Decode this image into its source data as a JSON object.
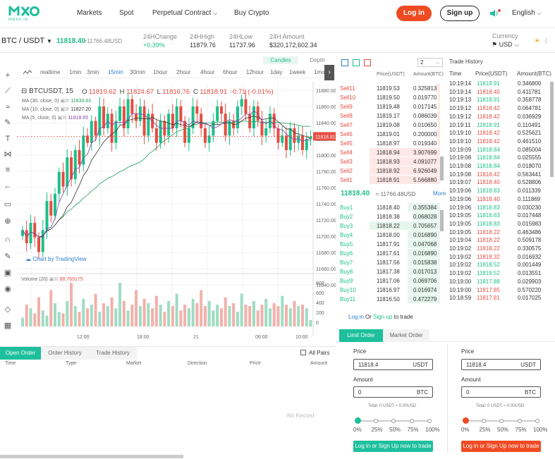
{
  "colors": {
    "green": "#1dbf8a",
    "red": "#e54d42",
    "accent": "#f04a23",
    "teal": "#1dbf9c"
  },
  "header": {
    "logo_main": "mexo",
    "logo_sub": "mexo.io",
    "nav": [
      "Markets",
      "Spot",
      "Perpetual Contract",
      "Buy Crypto"
    ],
    "login": "Log in",
    "signup": "Sign up",
    "language": "English"
  },
  "ticker": {
    "pair": "BTC / USDT",
    "price": "11818.40",
    "price_usd": "≈11766.48USD",
    "stats": [
      {
        "label": "24HChange",
        "value": "+0.39%"
      },
      {
        "label": "24HHigh",
        "value": "11879.76"
      },
      {
        "label": "24HLow",
        "value": "11737.96"
      },
      {
        "label": "24H Amount",
        "value": "$320,172,602.34"
      }
    ],
    "currency_label": "Currency",
    "currency": "USD"
  },
  "chart": {
    "tabs": [
      "Candles",
      "Depth"
    ],
    "intervals": [
      "realtime",
      "1min",
      "3min",
      "15min",
      "30min",
      "1hour",
      "2hour",
      "4hour",
      "6hour",
      "12hour",
      "1day",
      "1week",
      "1mon"
    ],
    "active_interval": "15min",
    "symbol": "BTCUSDT, 15",
    "ohlc": {
      "o_label": "O",
      "o": "11819.62",
      "h_label": "H",
      "h": "11824.67",
      "l_label": "L",
      "l": "11816.76",
      "c_label": "C",
      "c": "11818.91",
      "chg": "-0.71 (-0.01%)"
    },
    "ma": [
      {
        "label": "MA (30, close, 0)",
        "value": "11833.63",
        "color": "#1d9a5a"
      },
      {
        "label": "MA (10, close, 0)",
        "value": "11827.20",
        "color": "#333"
      },
      {
        "label": "MA (5, close, 0)",
        "value": "11818.65",
        "color": "#8a3fa8"
      }
    ],
    "price_ticks": [
      "11880.00",
      "11860.00",
      "11840.00",
      "11820.00",
      "11800.00",
      "11780.00",
      "11760.00",
      "11740.00",
      "11720.00",
      "11700.00",
      "11680.00",
      "11660.00",
      "11640.00"
    ],
    "current_price": "11818.91",
    "volume_label": "Volume (20)",
    "volume_value": "88.769175",
    "volume_ticks": [
      "800",
      "600",
      "400",
      "200",
      "0"
    ],
    "time_ticks": [
      "12:00",
      "18:00",
      "21",
      "06:00",
      "10:00"
    ],
    "watermark": "Chart by TradingView"
  },
  "chart_data": {
    "type": "candlestick",
    "title": "BTCUSDT, 15",
    "ylim": [
      11640,
      11890
    ],
    "closes": [
      11690,
      11672,
      11700,
      11680,
      11660,
      11690,
      11730,
      11710,
      11740,
      11770,
      11750,
      11790,
      11760,
      11800,
      11780,
      11820,
      11810,
      11840,
      11820,
      11860,
      11830,
      11850,
      11810,
      11840,
      11860,
      11830,
      11870,
      11850,
      11840,
      11860,
      11820,
      11850,
      11830,
      11810,
      11840,
      11820,
      11850,
      11830,
      11860,
      11840,
      11810,
      11830,
      11860,
      11850,
      11830,
      11810,
      11820,
      11840,
      11860,
      11850,
      11820,
      11840,
      11830,
      11860,
      11870,
      11850,
      11830,
      11860,
      11840,
      11820,
      11830,
      11850,
      11830,
      11810,
      11820,
      11800,
      11830,
      11810,
      11820,
      11800,
      11815,
      11819
    ],
    "volumes": [
      120,
      300,
      250,
      180,
      400,
      220,
      150,
      500,
      320,
      200,
      180,
      350,
      600,
      280,
      200,
      380,
      250,
      300,
      450,
      200,
      320,
      280,
      400,
      250,
      600,
      350,
      220,
      300,
      500,
      280,
      380,
      320,
      250,
      420,
      300,
      200,
      350,
      280,
      450,
      220,
      300,
      250,
      380,
      320,
      500,
      280,
      350,
      220,
      300,
      250,
      400,
      280,
      320,
      200,
      450,
      300,
      280,
      350,
      220,
      300,
      380,
      250,
      320,
      280,
      420,
      300,
      250,
      350,
      280,
      300,
      250,
      89
    ]
  },
  "orderbook": {
    "precision": "2",
    "col_price": "Price(USDT)",
    "col_amount": "Amount(BTC)",
    "sells": [
      {
        "label": "Sell11",
        "price": "11819.53",
        "amount": "0.325813",
        "depth": 0.04
      },
      {
        "label": "Sell10",
        "price": "11819.50",
        "amount": "0.019770",
        "depth": 0.02
      },
      {
        "label": "Sell9",
        "price": "11819.48",
        "amount": "0.017145",
        "depth": 0.02
      },
      {
        "label": "Sell8",
        "price": "11819.17",
        "amount": "0.086039",
        "depth": 0.03
      },
      {
        "label": "Sell7",
        "price": "11819.08",
        "amount": "0.010650",
        "depth": 0.02
      },
      {
        "label": "Sell6",
        "price": "11819.01",
        "amount": "0.200000",
        "depth": 0.04
      },
      {
        "label": "Sell5",
        "price": "11818.97",
        "amount": "0.019340",
        "depth": 0.02
      },
      {
        "label": "Sell4",
        "price": "11818.94",
        "amount": "3.907699",
        "depth": 0.65
      },
      {
        "label": "Sell3",
        "price": "11818.93",
        "amount": "4.091077",
        "depth": 0.65
      },
      {
        "label": "Sell2",
        "price": "11818.92",
        "amount": "6.926049",
        "depth": 0.65
      },
      {
        "label": "Sell1",
        "price": "11818.91",
        "amount": "5.566880",
        "depth": 0.65
      }
    ],
    "mid_price": "11818.40",
    "mid_usd": "≈ 11766.48USD",
    "more": "More",
    "buys": [
      {
        "label": "Buy1",
        "price": "11818.40",
        "amount": "0.355384",
        "depth": 0.3
      },
      {
        "label": "Buy2",
        "price": "11818.38",
        "amount": "0.068028",
        "depth": 0.25
      },
      {
        "label": "Buy3",
        "price": "11818.22",
        "amount": "0.705657",
        "depth": 0.65
      },
      {
        "label": "Buy4",
        "price": "11818.00",
        "amount": "0.016890",
        "depth": 0.3
      },
      {
        "label": "Buy5",
        "price": "11817.91",
        "amount": "0.047068",
        "depth": 0.3
      },
      {
        "label": "Buy6",
        "price": "11817.61",
        "amount": "0.016890",
        "depth": 0.3
      },
      {
        "label": "Buy7",
        "price": "11817.56",
        "amount": "0.015838",
        "depth": 0.3
      },
      {
        "label": "Buy8",
        "price": "11817.38",
        "amount": "0.017013",
        "depth": 0.3
      },
      {
        "label": "Buy9",
        "price": "11817.06",
        "amount": "0.069706",
        "depth": 0.3
      },
      {
        "label": "Buy10",
        "price": "11816.97",
        "amount": "0.016974",
        "depth": 0.3
      },
      {
        "label": "Buy11",
        "price": "11816.50",
        "amount": "0.472279",
        "depth": 0.3
      }
    ]
  },
  "trade_history": {
    "title": "Trade History",
    "cols": [
      "Time",
      "Price(USDT)",
      "Amount(BTC)"
    ],
    "rows": [
      [
        "10:19:14",
        "11818.91",
        "0.346800",
        "g"
      ],
      [
        "10:19:14",
        "11818.40",
        "0.411781",
        "r"
      ],
      [
        "10:19:13",
        "11818.91",
        "0.358778",
        "g"
      ],
      [
        "10:19:12",
        "11818.42",
        "0.064781",
        "r"
      ],
      [
        "10:19:12",
        "11818.42",
        "0.036929",
        "r"
      ],
      [
        "10:19:11",
        "11818.91",
        "0.110491",
        "g"
      ],
      [
        "10:19:10",
        "11818.42",
        "0.525621",
        "r"
      ],
      [
        "10:19:10",
        "11818.42",
        "0.461510",
        "r"
      ],
      [
        "10:19:09",
        "11818.84",
        "0.085004",
        "g"
      ],
      [
        "10:19:08",
        "11818.84",
        "0.025555",
        "g"
      ],
      [
        "10:19:08",
        "11818.84",
        "0.018070",
        "g"
      ],
      [
        "10:19:08",
        "11818.42",
        "0.563441",
        "r"
      ],
      [
        "10:19:07",
        "11818.40",
        "0.528806",
        "r"
      ],
      [
        "10:19:06",
        "11818.83",
        "0.011339",
        "g"
      ],
      [
        "10:19:06",
        "11818.40",
        "0.111869",
        "r"
      ],
      [
        "10:19:06",
        "11818.83",
        "0.030230",
        "g"
      ],
      [
        "10:19:05",
        "11818.83",
        "0.017448",
        "g"
      ],
      [
        "10:19:05",
        "11818.83",
        "0.015983",
        "g"
      ],
      [
        "10:19:05",
        "11818.22",
        "0.463486",
        "r"
      ],
      [
        "10:19:04",
        "11818.22",
        "0.509178",
        "r"
      ],
      [
        "10:19:02",
        "11818.22",
        "0.330575",
        "r"
      ],
      [
        "10:19:02",
        "11818.32",
        "0.016932",
        "r"
      ],
      [
        "10:19:02",
        "11818.52",
        "0.001449",
        "g"
      ],
      [
        "10:19:02",
        "11818.52",
        "0.013551",
        "g"
      ],
      [
        "10:19:00",
        "11817.88",
        "0.029903",
        "g"
      ],
      [
        "10:19:00",
        "11817.85",
        "0.570220",
        "r"
      ],
      [
        "10:18:59",
        "11817.81",
        "0.017025",
        "r"
      ]
    ]
  },
  "orders": {
    "tabs": [
      "Open Order",
      "Order History",
      "Trade History"
    ],
    "all_pairs": "All Pairs",
    "cols": [
      "Time",
      "Type",
      "Market",
      "Direction",
      "Price",
      "Amount"
    ],
    "empty": "No Record"
  },
  "trade": {
    "login_prompt_login": "Log in",
    "login_prompt_or": "Or",
    "login_prompt_signup": "Sign up",
    "login_prompt_to": "to trade",
    "tabs": [
      "Limit Order",
      "Market Order"
    ],
    "price_label": "Price",
    "amount_label": "Amount",
    "price_value": "11818.4",
    "price_unit": "USDT",
    "amount_value": "0",
    "amount_unit": "BTC",
    "total": "Total: 0 USDT ≈ 0.00USD",
    "pcts": [
      "0%",
      "25%",
      "50%",
      "75%",
      "100%"
    ],
    "buy_btn": "Log in or Sign Up now to trade",
    "sell_btn": "Log in or Sign Up now to trade"
  }
}
